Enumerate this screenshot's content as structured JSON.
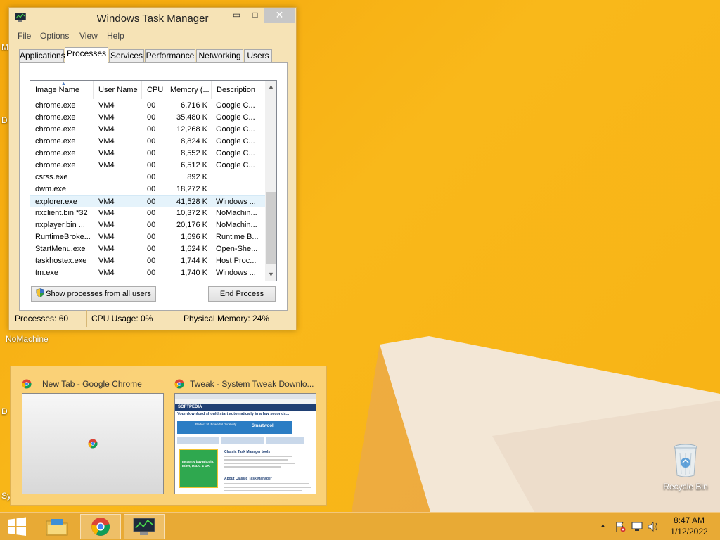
{
  "task_manager": {
    "title": "Windows Task Manager",
    "controls": {
      "minimize": "▭",
      "maximize": "□",
      "close": "✕"
    },
    "menu": [
      "File",
      "Options",
      "View",
      "Help"
    ],
    "tabs": [
      "Applications",
      "Processes",
      "Services",
      "Performance",
      "Networking",
      "Users"
    ],
    "active_tab": "Processes",
    "columns": [
      "Image Name",
      "User Name",
      "CPU",
      "Memory (...",
      "Description"
    ],
    "rows": [
      [
        "chrome.exe",
        "VM4",
        "00",
        "6,716 K",
        "Google C..."
      ],
      [
        "chrome.exe",
        "VM4",
        "00",
        "35,480 K",
        "Google C..."
      ],
      [
        "chrome.exe",
        "VM4",
        "00",
        "12,268 K",
        "Google C..."
      ],
      [
        "chrome.exe",
        "VM4",
        "00",
        "8,824 K",
        "Google C..."
      ],
      [
        "chrome.exe",
        "VM4",
        "00",
        "8,552 K",
        "Google C..."
      ],
      [
        "chrome.exe",
        "VM4",
        "00",
        "6,512 K",
        "Google C..."
      ],
      [
        "csrss.exe",
        "",
        "00",
        "892 K",
        ""
      ],
      [
        "dwm.exe",
        "",
        "00",
        "18,272 K",
        ""
      ],
      [
        "explorer.exe",
        "VM4",
        "00",
        "41,528 K",
        "Windows ..."
      ],
      [
        "nxclient.bin *32",
        "VM4",
        "00",
        "10,372 K",
        "NoMachin..."
      ],
      [
        "nxplayer.bin ...",
        "VM4",
        "00",
        "20,176 K",
        "NoMachin..."
      ],
      [
        "RuntimeBroke...",
        "VM4",
        "00",
        "1,696 K",
        "Runtime B..."
      ],
      [
        "StartMenu.exe",
        "VM4",
        "00",
        "1,624 K",
        "Open-She..."
      ],
      [
        "taskhostex.exe",
        "VM4",
        "00",
        "1,744 K",
        "Host Proc..."
      ],
      [
        "tm.exe",
        "VM4",
        "00",
        "1,740 K",
        "Windows ..."
      ]
    ],
    "selected_row": 8,
    "show_all_button": "Show processes from all users",
    "end_process_button": "End Process",
    "status": {
      "processes": "Processes: 60",
      "cpu": "CPU Usage: 0%",
      "memory": "Physical Memory: 24%"
    }
  },
  "desktop": {
    "nomachine_label": "NoMachine",
    "recycle_bin_label": "Recycle Bin",
    "edge_letters": [
      "M",
      "D",
      "D",
      "Sy"
    ]
  },
  "thumbnail_preview": {
    "items": [
      {
        "title": "New Tab - Google Chrome"
      },
      {
        "title": "Tweak - System Tweak Downlo..."
      }
    ],
    "softpedia_site": "SOFTPEDIA",
    "softpedia_headline": "Your download should start automatically in a few seconds...",
    "ad_text": "Perfect fit. Powerful durability.",
    "ad_brand": "Smartwool",
    "section_title": "Classic Task Manager tools",
    "about_title": "About Classic Task Manager",
    "promo_text": "Instantly buy Bitcoin, Ether, USDC & DAI"
  },
  "taskbar": {
    "time": "8:47 AM",
    "date": "1/12/2022",
    "tray_chevron": "▲"
  },
  "colors": {
    "desktop": "#f7b014",
    "window_frame": "#f6e3b6",
    "selection": "#e5f3fb"
  }
}
